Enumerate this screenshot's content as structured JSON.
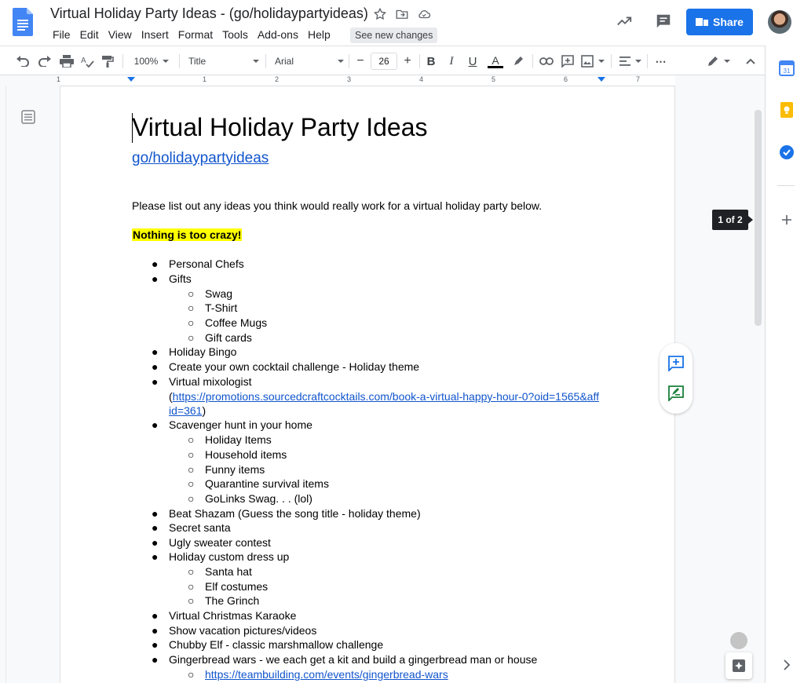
{
  "app": {
    "doc_title": "Virtual Holiday Party Ideas - (go/holidaypartyideas)",
    "see_new_changes": "See new changes",
    "share_label": "Share"
  },
  "menu": [
    "File",
    "Edit",
    "View",
    "Insert",
    "Format",
    "Tools",
    "Add-ons",
    "Help"
  ],
  "toolbar": {
    "zoom": "100%",
    "style": "Title",
    "font": "Arial",
    "font_size": "26",
    "text_color": "#000000"
  },
  "ruler_numbers": [
    "1",
    "1",
    "2",
    "3",
    "4",
    "5",
    "6",
    "7"
  ],
  "document": {
    "title": "Virtual Holiday Party Ideas",
    "subtitle_link": "go/holidaypartyideas",
    "intro": "Please list out any ideas you think would really work for a virtual holiday party below.",
    "highlight": "Nothing is too crazy!",
    "list": {
      "i0": "Personal Chefs",
      "i1": "Gifts",
      "i1_0": "Swag",
      "i1_1": "T-Shirt",
      "i1_2": "Coffee Mugs",
      "i1_3": "Gift cards",
      "i2": "Holiday Bingo",
      "i3": "Create your own cocktail challenge - Holiday theme",
      "i4": "Virtual mixologist",
      "i4_open": "(",
      "i4_link_a": "https://promotions.sourcedcraftcocktails.com/book-a-virtual-happy-hour-0?oid=1565&aff",
      "i4_link_b": "id=361",
      "i4_close": ")",
      "i5": "Scavenger hunt in your home",
      "i5_0": "Holiday Items",
      "i5_1": "Household items",
      "i5_2": "Funny items",
      "i5_3": "Quarantine survival items",
      "i5_4": "GoLinks Swag. . . (lol)",
      "i6": "Beat Shazam (Guess the song title - holiday theme)",
      "i7": "Secret santa",
      "i8": "Ugly sweater contest",
      "i9": "Holiday custom dress up",
      "i9_0": "Santa hat",
      "i9_1": "Elf costumes",
      "i9_2": "The Grinch",
      "i10": "Virtual Christmas Karaoke",
      "i11": "Show vacation pictures/videos",
      "i12": "Chubby Elf - classic marshmallow challenge",
      "i13": "Gingerbread wars - we each get a kit and build a gingerbread man or house",
      "i13_0": "https://teambuilding.com/events/gingerbread-wars"
    }
  },
  "page_indicator": "1 of 2",
  "colors": {
    "share_blue": "#1a73e8",
    "link": "#1155cc",
    "highlight": "#ffff00"
  },
  "icons": [
    "docs-logo-icon",
    "star-icon",
    "move-to-folder-icon",
    "cloud-saved-icon",
    "activity-trend-icon",
    "comments-icon",
    "undo-icon",
    "redo-icon",
    "print-icon",
    "spellcheck-icon",
    "paint-format-icon",
    "bold-icon",
    "italic-icon",
    "underline-icon",
    "text-color-icon",
    "highlight-color-icon",
    "link-icon",
    "add-comment-icon",
    "insert-image-icon",
    "align-icon",
    "more-icon",
    "editing-mode-icon",
    "collapse-icon",
    "outline-icon",
    "calendar-icon",
    "keep-icon",
    "tasks-icon",
    "add-addon-icon",
    "expand-panel-icon",
    "explore-icon"
  ]
}
